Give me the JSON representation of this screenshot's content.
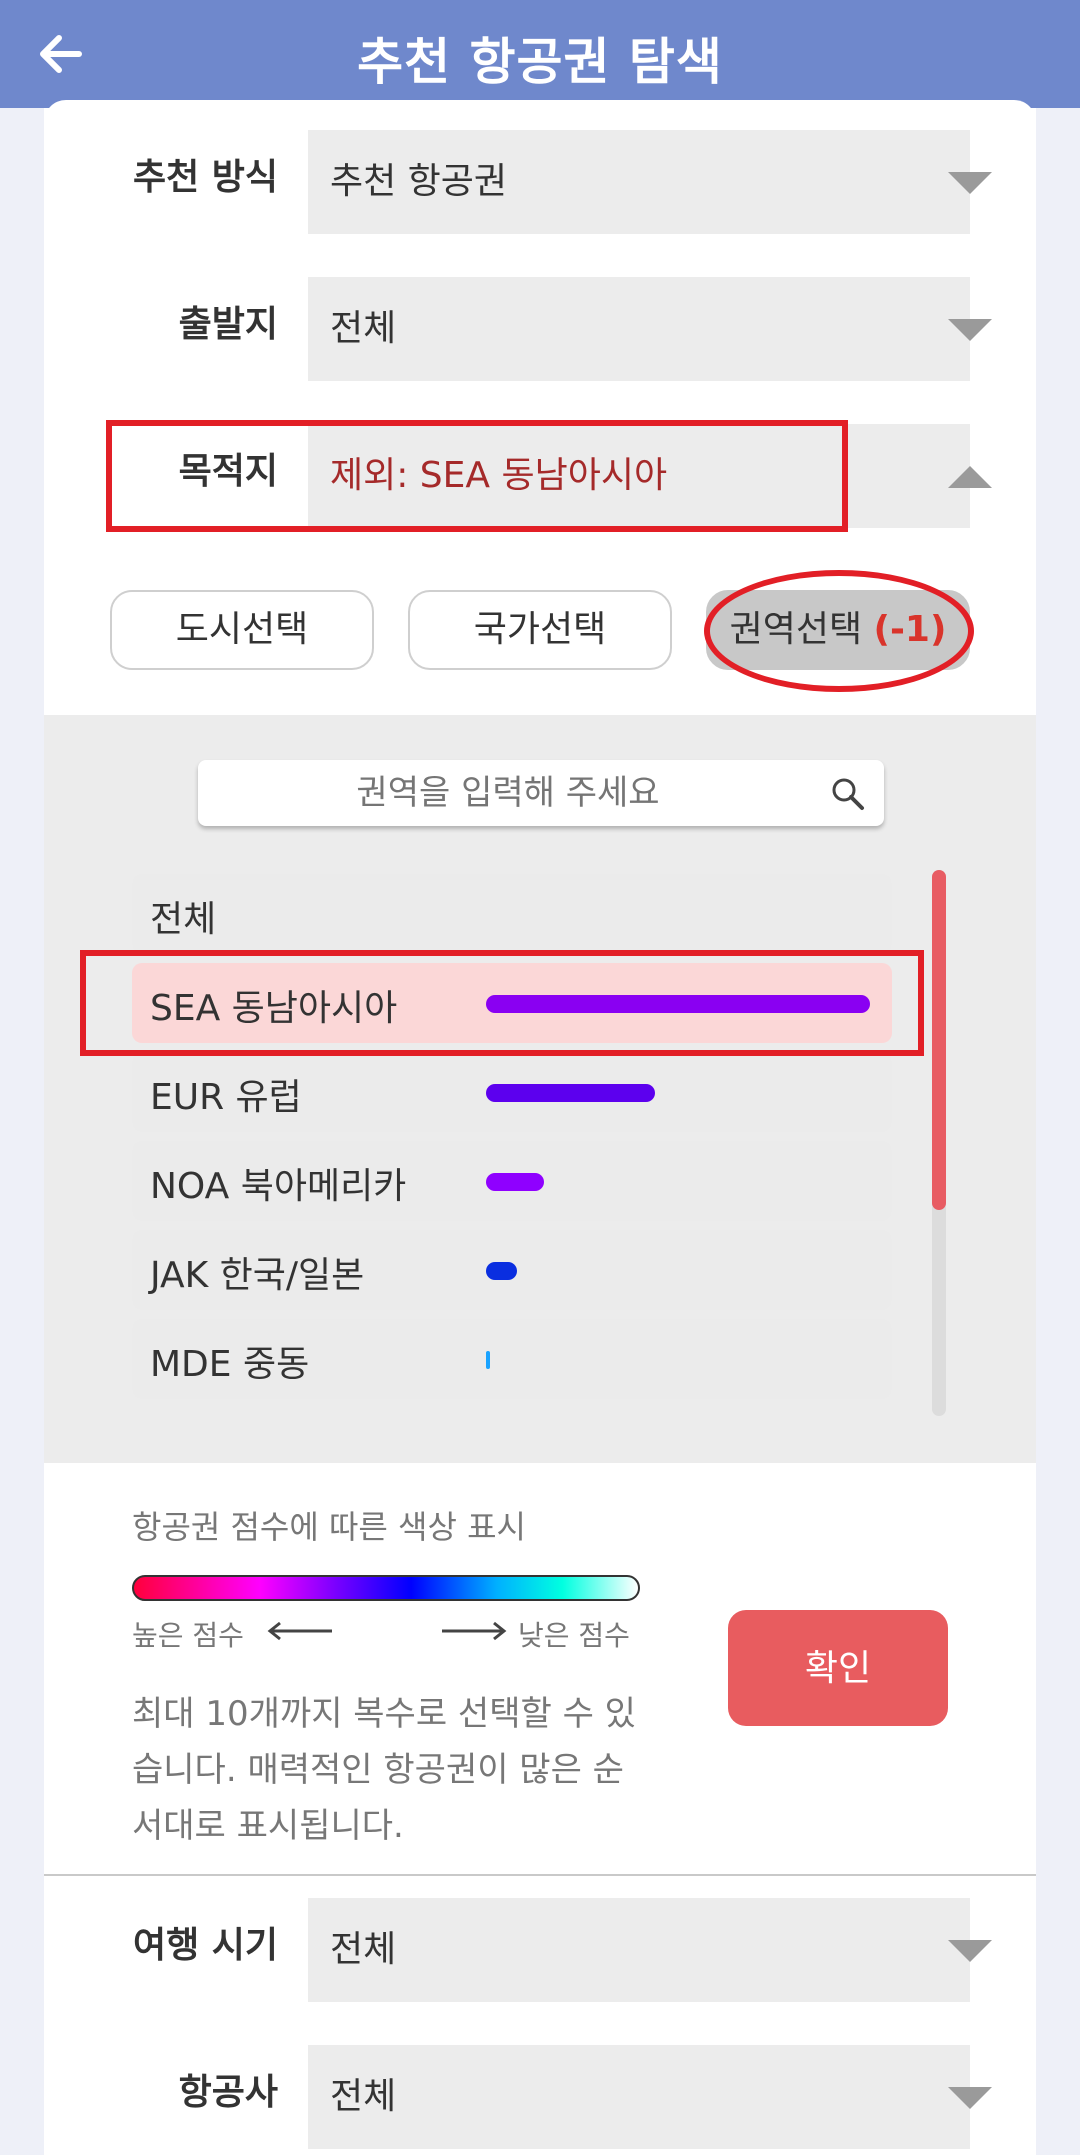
{
  "header": {
    "title": "추천 항공권 탐색"
  },
  "filters": {
    "method": {
      "label": "추천 방식",
      "value": "추천 항공권"
    },
    "origin": {
      "label": "출발지",
      "value": "전체"
    },
    "destination": {
      "label": "목적지",
      "value": "제외: SEA 동남아시아"
    },
    "period": {
      "label": "여행 시기",
      "value": "전체"
    },
    "airline": {
      "label": "항공사",
      "value": "전체"
    }
  },
  "tabs": [
    {
      "label": "도시선택"
    },
    {
      "label": "국가선택"
    },
    {
      "label": "권역선택",
      "count": "(-1)"
    }
  ],
  "search": {
    "placeholder": "권역을 입력해 주세요"
  },
  "regions": [
    {
      "label": "전체",
      "score": 0
    },
    {
      "label": "SEA 동남아시아",
      "score": 1.0,
      "color": "#8a00f2",
      "selected": true
    },
    {
      "label": "EUR 유럽",
      "score": 0.44,
      "color": "#5c00ee"
    },
    {
      "label": "NOA 북아메리카",
      "score": 0.15,
      "color": "#8f00ff"
    },
    {
      "label": "JAK 한국/일본",
      "score": 0.08,
      "color": "#0a2ee0"
    },
    {
      "label": "MDE 중동",
      "score": 0.01,
      "color": "#1aa3ff"
    }
  ],
  "legend": {
    "title": "항공권 점수에 따른 색상 표시",
    "high": "높은 점수",
    "low": "낮은 점수"
  },
  "confirm_label": "확인",
  "note": "최대 10개까지 복수로 선택할 수 있습니다. 매력적인 항공권이 많은 순서대로 표시됩니다.",
  "colors": {
    "header": "#6f88cc",
    "accent": "#e85c5f",
    "highlight": "#e21f26"
  }
}
